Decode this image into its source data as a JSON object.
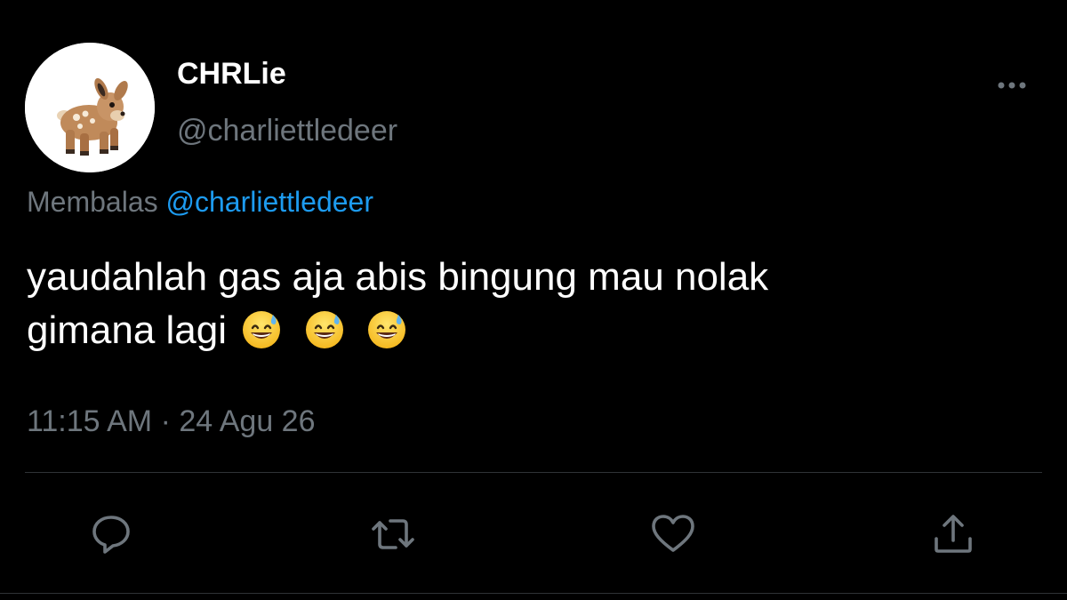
{
  "author": {
    "display_name": "CHRLie",
    "handle": "@charliettledeer"
  },
  "reply_context": {
    "prefix": "Membalas",
    "mention": "@charliettledeer"
  },
  "tweet": {
    "line1": "yaudahlah gas aja abis bingung mau nolak",
    "line2": "gimana lagi",
    "emoji": [
      "grinning-face-with-sweat",
      "grinning-face-with-sweat",
      "grinning-face-with-sweat"
    ]
  },
  "timestamp": "11:15 AM · 24 Agu 26",
  "actions": {
    "reply_icon": "reply-icon",
    "retweet_icon": "retweet-icon",
    "like_icon": "heart-icon",
    "share_icon": "share-icon"
  },
  "colors": {
    "background": "#000000",
    "text": "#ffffff",
    "secondary_text": "#6e767d",
    "link": "#1d9bf0",
    "divider": "#2f3336"
  }
}
